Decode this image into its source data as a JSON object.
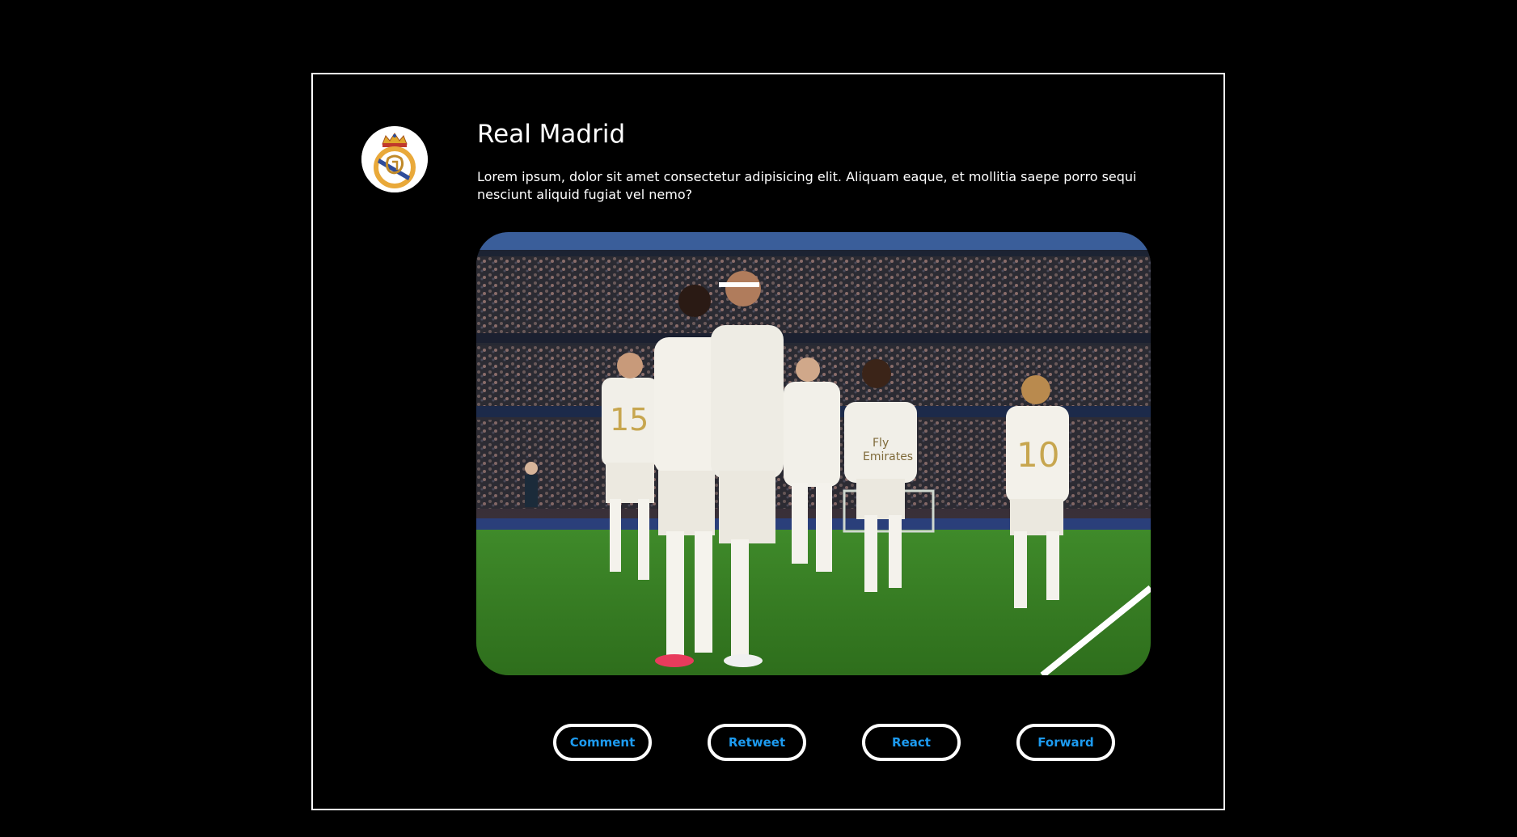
{
  "post": {
    "author": "Real Madrid",
    "text": "Lorem ipsum, dolor sit amet consectetur adipisicing elit. Aliquam eaque, et mollitia saepe porro sequi nesciunt aliquid fugiat vel nemo?",
    "avatar_icon": "real-madrid-crest",
    "image_subject": "players-celebrating-photo"
  },
  "actions": {
    "comment_label": "Comment",
    "retweet_label": "Retweet",
    "react_label": "React",
    "forward_label": "Forward"
  },
  "colors": {
    "background": "#000000",
    "border": "#ffffff",
    "accent": "#1d9bf0",
    "text": "#ffffff"
  }
}
